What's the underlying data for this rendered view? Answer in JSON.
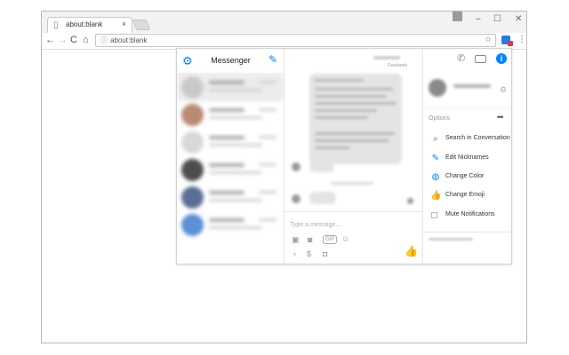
{
  "browser": {
    "tab_title": "about:blank",
    "tab_close": "×",
    "address": "about:blank",
    "window_controls": {
      "minimize": "–",
      "maximize": "☐",
      "close": "✕"
    },
    "nav": {
      "back": "←",
      "forward": "→",
      "reload": "C",
      "home": "⌂"
    },
    "star": "☆",
    "menu": "⋮"
  },
  "messenger": {
    "title": "Messenger",
    "composer_placeholder": "Type a message...",
    "header_sub": "Facebook",
    "options_label": "Options",
    "options_more": "•••",
    "options": [
      {
        "label": "Search in Conversation",
        "icon": "search-icon"
      },
      {
        "label": "Edit Nicknames",
        "icon": "pencil-icon"
      },
      {
        "label": "Change Color",
        "icon": "palette-icon"
      },
      {
        "label": "Change Emoji",
        "icon": "thumbs-up-icon"
      },
      {
        "label": "Mute Notifications",
        "icon": "checkbox"
      }
    ],
    "conversation_avatar_colors": [
      "#c9c9c9",
      "#b98a72",
      "#d8d8d8",
      "#4d4d4d",
      "#5a6f96",
      "#5b8fd6"
    ]
  },
  "colors": {
    "accent": "#0084ff"
  }
}
